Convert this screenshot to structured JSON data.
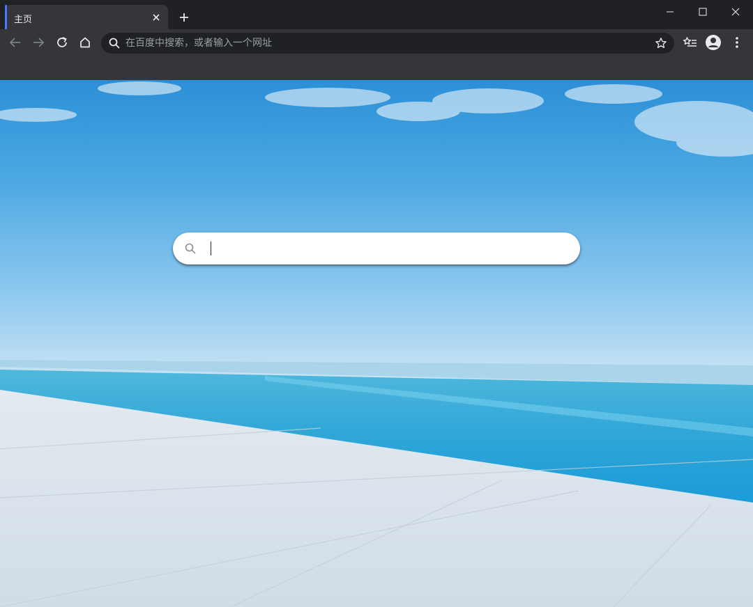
{
  "tab": {
    "title": "主页"
  },
  "omnibox": {
    "placeholder": "在百度中搜索，或者输入一个网址",
    "value": ""
  },
  "page_search": {
    "placeholder": "",
    "value": ""
  },
  "colors": {
    "tab_accent": "#4a78ff",
    "chrome_dark": "#202124",
    "chrome": "#35363a"
  }
}
